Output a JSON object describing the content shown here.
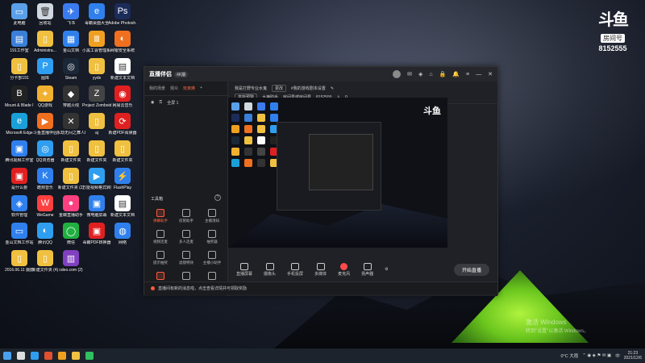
{
  "watermark": {
    "logo": "斗鱼",
    "room_label": "房间号",
    "room_number": "8152555"
  },
  "desktop_icons": [
    {
      "label": "此电脑",
      "color": "#5aa0e8",
      "glyph": "▭"
    },
    {
      "label": "回收站",
      "color": "#d0d8e0",
      "glyph": "🗑"
    },
    {
      "label": "飞书",
      "color": "#3b7bf0",
      "glyph": "✈"
    },
    {
      "label": "毒霸桌面大全",
      "color": "#2f80ed",
      "glyph": "e"
    },
    {
      "label": "Adobe Photosh...",
      "color": "#1c2c5a",
      "glyph": "Ps"
    },
    {
      "label": "191工作室",
      "color": "#3a7fd8",
      "glyph": "▤"
    },
    {
      "label": "Administra...",
      "color": "#f0c040",
      "glyph": "▯"
    },
    {
      "label": "金山文档",
      "color": "#2f80ed",
      "glyph": "▦"
    },
    {
      "label": "小黑工会管理系统",
      "color": "#f0a020",
      "glyph": "Ⅲ"
    },
    {
      "label": "网银安全系统",
      "color": "#f07020",
      "glyph": "◐"
    },
    {
      "label": "分卡部191",
      "color": "#f0c040",
      "glyph": "▯"
    },
    {
      "label": "图库",
      "color": "#2f9ef0",
      "glyph": "P"
    },
    {
      "label": "Steam",
      "color": "#1b2838",
      "glyph": "◎"
    },
    {
      "label": "yyds",
      "color": "#f0c040",
      "glyph": "▯"
    },
    {
      "label": "新建文本文档",
      "color": "#ffffff",
      "glyph": "▤"
    },
    {
      "label": "Mount & Blade II...",
      "color": "#222",
      "glyph": "B"
    },
    {
      "label": "QQ游戏",
      "color": "#f0b030",
      "glyph": "✦"
    },
    {
      "label": "穿越火线",
      "color": "#333",
      "glyph": "◆"
    },
    {
      "label": "Project Zomboid",
      "color": "#444",
      "glyph": "Z"
    },
    {
      "label": "网易云音乐",
      "color": "#e02020",
      "glyph": "◉"
    },
    {
      "label": "Microsoft Edge",
      "color": "#1aa0d8",
      "glyph": "e"
    },
    {
      "label": "斗鱼直播伴侣",
      "color": "#f07020",
      "glyph": "▶"
    },
    {
      "label": "永劫无间之舞人Dance of F...",
      "color": "#333",
      "glyph": "✕"
    },
    {
      "label": "aj",
      "color": "#f0c040",
      "glyph": "▯"
    },
    {
      "label": "新建PDF阅读器",
      "color": "#e02020",
      "glyph": "⟳"
    },
    {
      "label": "腾讯视频工作室",
      "color": "#2f80ed",
      "glyph": "▣"
    },
    {
      "label": "QQ浏览器",
      "color": "#2f9ef0",
      "glyph": "◎"
    },
    {
      "label": "新建文件夹",
      "color": "#f0c040",
      "glyph": "▯"
    },
    {
      "label": "新建文件夹",
      "color": "#f0c040",
      "glyph": "▯"
    },
    {
      "label": "新建文件夹",
      "color": "#f0c040",
      "glyph": "▯"
    },
    {
      "label": "是什么要",
      "color": "#e02020",
      "glyph": "▣"
    },
    {
      "label": "酷狗音乐",
      "color": "#2f80ed",
      "glyph": "K"
    },
    {
      "label": "新建文件夹 (2)",
      "color": "#f0c040",
      "glyph": "▯"
    },
    {
      "label": "万能视频格式转换",
      "color": "#2f9ef0",
      "glyph": "▶"
    },
    {
      "label": "FlashPlay",
      "color": "#2f80ed",
      "glyph": "⚡"
    },
    {
      "label": "软件管理",
      "color": "#2f80ed",
      "glyph": "◈"
    },
    {
      "label": "WeGame",
      "color": "#ff4040",
      "glyph": "W"
    },
    {
      "label": "金蝶直播助手",
      "color": "#ff4080",
      "glyph": "●"
    },
    {
      "label": "微电脑屏幕",
      "color": "#2f80ed",
      "glyph": "▣"
    },
    {
      "label": "新建文本文档",
      "color": "#ffffff",
      "glyph": "▤"
    },
    {
      "label": "金山文档工作站",
      "color": "#2f80ed",
      "glyph": "▭"
    },
    {
      "label": "腾讯QQ",
      "color": "#2f9ef0",
      "glyph": "◐"
    },
    {
      "label": "微信",
      "color": "#20b040",
      "glyph": "◯"
    },
    {
      "label": "毒霸PDF转换器",
      "color": "#e02020",
      "glyph": "▣"
    },
    {
      "label": "网络",
      "color": "#2f80ed",
      "glyph": "◍"
    },
    {
      "label": "2016.06.11 摄影",
      "color": "#f0c040",
      "glyph": "▯"
    },
    {
      "label": "新建文件夹 (4)",
      "color": "#f0c040",
      "glyph": "▯"
    },
    {
      "label": "cdeo.com (2)",
      "color": "#8040c0",
      "glyph": "▥"
    }
  ],
  "app": {
    "title": "直播伴侣",
    "badge": "4K版",
    "titlebar_icons": [
      "avatar",
      "msg-icon",
      "gift-icon",
      "home-icon",
      "lock-icon",
      "bell-icon",
      "menu-icon",
      "minimize-icon",
      "close-icon"
    ],
    "left_tabs": [
      "我的场景",
      "观众",
      "玩家席",
      "+"
    ],
    "active_tab_index": 2,
    "scene_label": "全屏 1",
    "tools_title": "工具箱",
    "tools": [
      {
        "label": "弹幕助手",
        "highlight": true
      },
      {
        "label": "房管助手",
        "highlight": false
      },
      {
        "label": "主播须知",
        "highlight": false
      },
      {
        "label": "视频连麦",
        "highlight": false
      },
      {
        "label": "多人连麦",
        "highlight": false
      },
      {
        "label": "抽奖器",
        "highlight": false
      },
      {
        "label": "提示抽奖",
        "highlight": false
      },
      {
        "label": "滤镜特效",
        "highlight": false
      },
      {
        "label": "主播小助手",
        "highlight": false
      },
      {
        "label": "新人任务",
        "highlight": true
      },
      {
        "label": "直播切片",
        "highlight": false
      },
      {
        "label": "更多",
        "highlight": false
      }
    ],
    "room": {
      "title": "我是打野专业水鬼",
      "edit_tag": "更改",
      "category": "#我的游戏剧本设置",
      "mode": "高能预警",
      "host_tag": "大神助手",
      "room_id_label": "房间号或房间号",
      "room_id": "8152555",
      "viewers": "0"
    },
    "preview_logo": "斗鱼",
    "bottom_buttons": [
      {
        "label": "直播屏幕",
        "red": false
      },
      {
        "label": "摄像头",
        "red": false
      },
      {
        "label": "手机投屏",
        "red": false
      },
      {
        "label": "多媒体",
        "red": false
      },
      {
        "label": "麦克风",
        "red": true
      },
      {
        "label": "扬声器",
        "red": false
      }
    ],
    "start_button": "开始直播",
    "status_text": "直播间有新的消息啦，点击查看详情并可领取奖励"
  },
  "activate": {
    "line1": "激活 Windows",
    "line2": "转到\"设置\"以激活 Windows。"
  },
  "taskbar": {
    "weather": "0°C 大雨",
    "time": "21:23",
    "date": "2021/12/6",
    "lang": "中"
  }
}
